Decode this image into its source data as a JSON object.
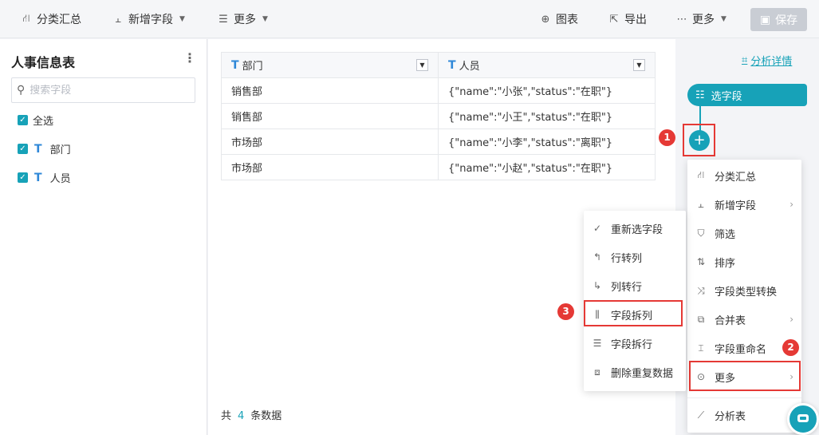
{
  "toolbar": {
    "group_label": "分类汇总",
    "add_field_label": "新增字段",
    "more_label": "更多",
    "chart_label": "图表",
    "export_label": "导出",
    "more_right_label": "更多",
    "save_label": "保存"
  },
  "left": {
    "title": "人事信息表",
    "search_placeholder": "搜索字段",
    "select_all": "全选",
    "fields": [
      "部门",
      "人员"
    ]
  },
  "table": {
    "headers": [
      "部门",
      "人员"
    ],
    "rows": [
      [
        "销售部",
        "{\"name\":\"小张\",\"status\":\"在职\"}"
      ],
      [
        "销售部",
        "{\"name\":\"小王\",\"status\":\"在职\"}"
      ],
      [
        "市场部",
        "{\"name\":\"小李\",\"status\":\"离职\"}"
      ],
      [
        "市场部",
        "{\"name\":\"小赵\",\"status\":\"在职\"}"
      ]
    ],
    "count_prefix": "共",
    "count_value": "4",
    "count_suffix": "条数据"
  },
  "flow": {
    "analysis_link": "分析详情",
    "node_label": "选字段",
    "plus_symbol": "+"
  },
  "main_menu": {
    "items": [
      "分类汇总",
      "新增字段",
      "筛选",
      "排序",
      "字段类型转换",
      "合并表",
      "字段重命名",
      "更多"
    ],
    "bottom_item": "分析表"
  },
  "sub_menu": {
    "items": [
      "重新选字段",
      "行转列",
      "列转行",
      "字段拆列",
      "字段拆行",
      "删除重复数据"
    ]
  },
  "badges": [
    "1",
    "2",
    "3"
  ],
  "colors": {
    "accent": "#17a2b8",
    "highlight": "#e53935",
    "save_disabled": "#c9cdd4"
  }
}
